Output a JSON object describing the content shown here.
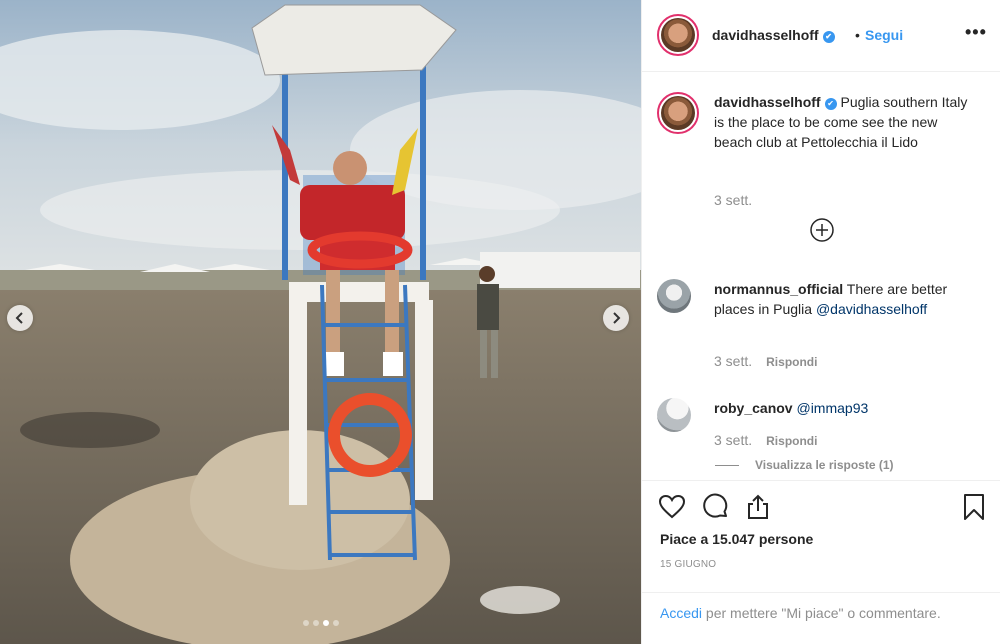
{
  "header": {
    "username": "davidhasselhoff",
    "separator": "•",
    "follow_label": "Segui",
    "more_label": "•••"
  },
  "caption": {
    "username": "davidhasselhoff",
    "text": "Puglia southern Italy is the place to be come see the new beach club at Pettolecchia il Lido",
    "time": "3 sett."
  },
  "comments": [
    {
      "username": "normannus_official",
      "text": "There are better places in Puglia",
      "mention": "@davidhasselhoff",
      "time": "3 sett.",
      "reply_label": "Rispondi"
    },
    {
      "username": "roby_canov",
      "text": "",
      "mention": "@immap93",
      "time": "3 sett.",
      "reply_label": "Rispondi",
      "view_replies": "Visualizza le risposte (1)"
    }
  ],
  "stats": {
    "likes": "Piace a 15.047 persone",
    "date": "15 GIUGNO"
  },
  "footer": {
    "login_label": "Accedi",
    "rest": "per mettere \"Mi piace\" o commentare."
  },
  "carousel": {
    "count": 4,
    "active_index": 2
  },
  "colors": {
    "accent": "#3897f0",
    "story_ring": "#e1306c",
    "muted": "#8e8e8e"
  },
  "icons": [
    "verified-icon",
    "more-icon",
    "load-more-icon",
    "heart-icon",
    "comment-icon",
    "share-icon",
    "bookmark-icon",
    "chevron-left-icon",
    "chevron-right-icon"
  ]
}
